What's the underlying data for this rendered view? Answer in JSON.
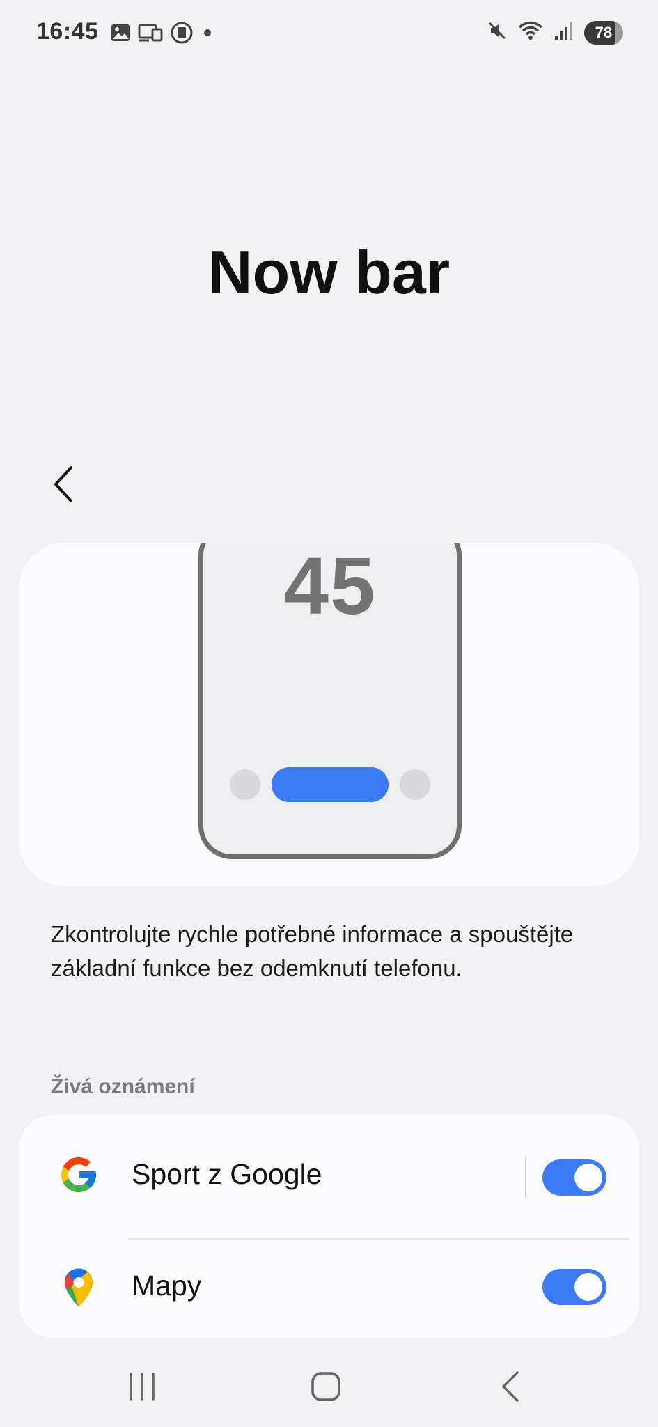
{
  "status_bar": {
    "time": "16:45",
    "battery_level": "78",
    "battery_fraction": 0.78,
    "left_icons": [
      "gallery-icon",
      "cast-icon",
      "screen-record-icon",
      "dot-icon"
    ],
    "right_icons": [
      "mute-icon",
      "wifi-icon",
      "signal-icon",
      "battery-icon"
    ]
  },
  "page": {
    "title": "Now bar"
  },
  "illustration": {
    "clock_text": "45",
    "accent_color": "#3b7bf5"
  },
  "description": "Zkontrolujte rychle potřebné informace a spouštějte základní funkce bez odemknutí telefonu.",
  "section": {
    "header": "Živá oznámení"
  },
  "apps": [
    {
      "label": "Sport z Google",
      "icon": "google-icon",
      "enabled": true
    },
    {
      "label": "Mapy",
      "icon": "maps-icon",
      "enabled": true
    }
  ],
  "nav": {
    "icons": [
      "recents-icon",
      "home-icon",
      "back-icon"
    ]
  }
}
